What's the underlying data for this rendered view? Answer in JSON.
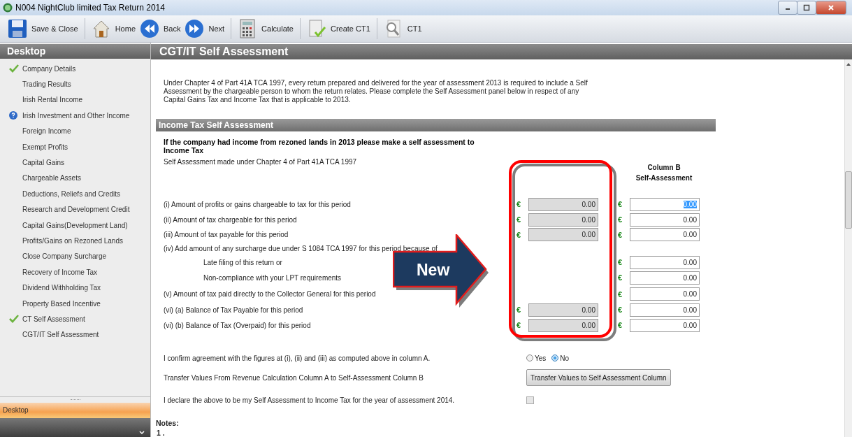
{
  "window": {
    "title": "N004 NightClub limited Tax Return 2014"
  },
  "toolbar": [
    {
      "label": "Save & Close"
    },
    {
      "label": "Home"
    },
    {
      "label": "Back"
    },
    {
      "label": "Next"
    },
    {
      "label": "Calculate"
    },
    {
      "label": "Create CT1"
    },
    {
      "label": "CT1"
    }
  ],
  "sidebar": {
    "title": "Desktop",
    "items": [
      {
        "label": "Company Details",
        "kind": "done"
      },
      {
        "label": "Trading Results",
        "kind": "plain"
      },
      {
        "label": "Irish Rental Income",
        "kind": "plain"
      },
      {
        "label": "Irish Investment and Other Income",
        "kind": "help"
      },
      {
        "label": "Foreign Income",
        "kind": "plain"
      },
      {
        "label": "Exempt Profits",
        "kind": "plain"
      },
      {
        "label": "Capital Gains",
        "kind": "plain"
      },
      {
        "label": "Chargeable Assets",
        "kind": "plain"
      },
      {
        "label": "Deductions, Reliefs and Credits",
        "kind": "plain"
      },
      {
        "label": "Research and Development Credit",
        "kind": "plain"
      },
      {
        "label": "Capital Gains(Development Land)",
        "kind": "plain"
      },
      {
        "label": "Profits/Gains on Rezoned Lands",
        "kind": "plain"
      },
      {
        "label": "Close Company Surcharge",
        "kind": "plain"
      },
      {
        "label": "Recovery of Income Tax",
        "kind": "plain"
      },
      {
        "label": "Dividend Withholding Tax",
        "kind": "plain"
      },
      {
        "label": "Property Based Incentive",
        "kind": "plain"
      },
      {
        "label": "CT Self Assessment",
        "kind": "done"
      },
      {
        "label": "CGT/IT Self Assessment",
        "kind": "plain"
      }
    ],
    "pane_button": "Desktop"
  },
  "page": {
    "title": "CGT/IT Self Assessment",
    "intro": "Under Chapter 4 of Part 41A TCA 1997, every return prepared and delivered for the year of assessment 2013 is required to include a Self Assessment by the chargeable person to whom the return relates. Please complete the Self Assessment panel below in respect of any Capital Gains Tax and Income Tax that is applicable to 2013.",
    "section_title": "Income Tax Self Assessment",
    "question": "If the company had income from rezoned lands in 2013 please make a self assessment to Income Tax",
    "subtitle": "Self Assessment made under Chapter 4 of Part 41A TCA 1997",
    "column_b_title": "Column B",
    "column_b_subtitle": "Self-Assessment",
    "rows": [
      {
        "label": "(i) Amount of profits or gains chargeable to tax for this period",
        "kind": "item",
        "column_a": {
          "currency": "€",
          "value": "0.00"
        },
        "column_b": {
          "currency": "€",
          "value": "0.00",
          "focused": true
        }
      },
      {
        "label": "(ii) Amount of tax chargeable for this period",
        "kind": "item",
        "column_a": {
          "currency": "€",
          "value": "0.00"
        },
        "column_b": {
          "currency": "€",
          "value": "0.00",
          "focused": false
        }
      },
      {
        "label": "(iii) Amount of tax payable for this period",
        "kind": "item",
        "column_a": {
          "currency": "€",
          "value": "0.00"
        },
        "column_b": {
          "currency": "€",
          "value": "0.00",
          "focused": false
        }
      },
      {
        "label": "(iv) Add amount of any surcharge due under S 1084 TCA 1997 for this period because of",
        "kind": "item"
      },
      {
        "label": "Late filing of this return or",
        "kind": "sub",
        "column_b": {
          "currency": "€",
          "value": "0.00",
          "focused": false
        }
      },
      {
        "label": "Non-compliance with your LPT requirements",
        "kind": "sub",
        "column_b": {
          "currency": "€",
          "value": "0.00",
          "focused": false
        }
      },
      {
        "label": "(v) Amount of tax paid directly to the Collector General for this period",
        "kind": "item",
        "column_b": {
          "currency": "€",
          "value": "0.00",
          "focused": false
        }
      },
      {
        "label": "(vi) (a) Balance of Tax Payable for this period",
        "kind": "item",
        "column_a": {
          "currency": "€",
          "value": "0.00"
        },
        "column_b": {
          "currency": "€",
          "value": "0.00",
          "focused": false
        }
      },
      {
        "label": "(vi) (b) Balance of Tax (Overpaid) for this period",
        "kind": "item",
        "column_a": {
          "currency": "€",
          "value": "0.00"
        },
        "column_b": {
          "currency": "€",
          "value": "0.00",
          "focused": false
        }
      }
    ],
    "confirm": {
      "label": "I confirm agreement with the figures at (i), (ii) and (iii) as computed above in column A.",
      "options": [
        {
          "label": "Yes",
          "selected": false
        },
        {
          "label": "No",
          "selected": true
        }
      ]
    },
    "transfer": {
      "label": "Transfer Values From Revenue Calculation Column A to Self-Assessment Column B",
      "button": "Transfer Values to Self Assessment Column"
    },
    "declare": {
      "label": "I declare the above to be my Self Assessment to Income Tax for the year of assessment 2014.",
      "checked": false,
      "disabled": true
    },
    "notes_title": "Notes:",
    "notes": [
      "1 ."
    ]
  },
  "callout": {
    "label": "New"
  }
}
